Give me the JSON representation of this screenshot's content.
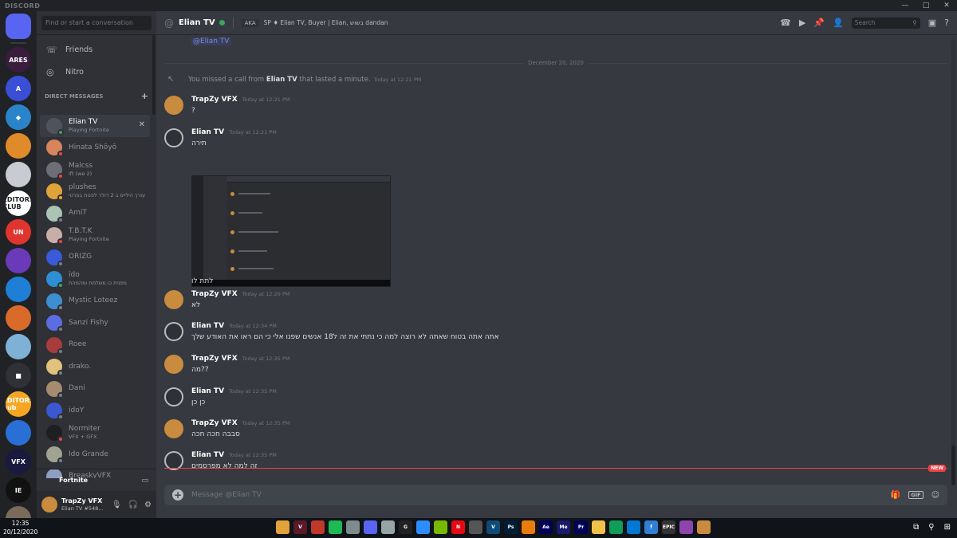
{
  "app": {
    "brand": "DISCORD",
    "window_controls": [
      "—",
      "□",
      "✕"
    ]
  },
  "colors": {
    "accent": "#5865f2",
    "online": "#3ba55d",
    "dnd": "#ed4245",
    "idle": "#faa81a",
    "offline": "#747f8d"
  },
  "sidebar": {
    "search_placeholder": "Find or start a conversation",
    "friends": "Friends",
    "nitro": "Nitro",
    "dm_header": "DIRECT MESSAGES",
    "dms": [
      {
        "name": "Elian TV",
        "sub": "Playing Fortnite",
        "status": "online",
        "color": "#4f545c"
      },
      {
        "name": "Hinata Shōyō",
        "sub": "",
        "status": "dnd",
        "color": "#d8845c"
      },
      {
        "name": "Malcss",
        "sub": "ift (we 2)",
        "status": "dnd",
        "color": "#6d6f78"
      },
      {
        "name": "plushes",
        "sub": "עורך הילייס ב 2 דולר לפנות בפרטי",
        "status": "idle",
        "color": "#e0a33a"
      },
      {
        "name": "AmiT",
        "sub": "",
        "status": "offline",
        "color": "#a9c4b5"
      },
      {
        "name": "T.B.T.K",
        "sub": "Playing Fortnite",
        "status": "dnd",
        "color": "#c9ada7"
      },
      {
        "name": "ORIZG",
        "sub": "",
        "status": "offline",
        "color": "#3a5bd9"
      },
      {
        "name": "ido",
        "sub": "מפנית כו משלמת ומהמהת",
        "status": "online",
        "color": "#2e8fd6"
      },
      {
        "name": "Mystic Loteez",
        "sub": "",
        "status": "offline",
        "color": "#3c8fd1"
      },
      {
        "name": "Sanzi Fishy",
        "sub": "",
        "status": "offline",
        "color": "#5b6ee1"
      },
      {
        "name": "Roee",
        "sub": "",
        "status": "offline",
        "color": "#a83c3c"
      },
      {
        "name": "drako.",
        "sub": "",
        "status": "offline",
        "color": "#e2c27a"
      },
      {
        "name": "Dani",
        "sub": "",
        "status": "offline",
        "color": "#a58b6f"
      },
      {
        "name": "idoY",
        "sub": "",
        "status": "offline",
        "color": "#3b57d1"
      },
      {
        "name": "Normiter",
        "sub": "VFX + GFX",
        "status": "dnd",
        "color": "#1e1f22"
      },
      {
        "name": "Ido Grande",
        "sub": "",
        "status": "offline",
        "color": "#a0a38f"
      },
      {
        "name": "BreaskyVFX",
        "sub": "",
        "status": "offline",
        "color": "#8e9fc2"
      }
    ],
    "activity": "Fortnite",
    "user": {
      "name": "TrapZy VFX",
      "tag": "Elian TV #548..."
    }
  },
  "guilds": [
    {
      "label": "",
      "color": "#5865f2"
    },
    {
      "label": "ARES",
      "color": "#3a1c3d"
    },
    {
      "label": "A",
      "color": "#3b4ed6"
    },
    {
      "label": "◆",
      "color": "#2a84c9"
    },
    {
      "label": "",
      "color": "#e08b2a"
    },
    {
      "label": "",
      "color": "#c8ccd2"
    },
    {
      "label": "EDITORS CLUB",
      "color": "#ffffff"
    },
    {
      "label": "UN",
      "color": "#e0342f"
    },
    {
      "label": "",
      "color": "#6a3ab8"
    },
    {
      "label": "",
      "color": "#1f7fd6"
    },
    {
      "label": "",
      "color": "#d96a2a"
    },
    {
      "label": "",
      "color": "#7fb1d6"
    },
    {
      "label": "■",
      "color": "#2f3136"
    },
    {
      "label": "EDITORS hub",
      "color": "#f5a623"
    },
    {
      "label": "",
      "color": "#2a6fd6"
    },
    {
      "label": "VFX",
      "color": "#1a1a40"
    },
    {
      "label": "IE",
      "color": "#111111"
    },
    {
      "label": "",
      "color": "#7a6a5a"
    }
  ],
  "header": {
    "at": "@",
    "name": "Elian TV",
    "aka_label": "AKA",
    "aka_value": "SP ♦ Elian TV, Buyer | Elian, בשוש dandan",
    "search": "Search"
  },
  "chat": {
    "mention": "@Elian TV",
    "date": "December 20, 2020",
    "call_prefix": "You missed a call from",
    "call_name": "Elian TV",
    "call_suffix": "that lasted a minute.",
    "call_time": "Today at 12:21 PM",
    "messages": [
      {
        "author": "TrapZy VFX",
        "time": "Today at 12:21 PM",
        "text": "?",
        "who": "trap"
      },
      {
        "author": "Elian TV",
        "time": "Today at 12:21 PM",
        "text": "תירה",
        "who": "elian"
      },
      {
        "author": "TrapZy VFX",
        "time": "Today at 12:29 PM",
        "text": "לא",
        "who": "trap"
      },
      {
        "author": "Elian TV",
        "time": "Today at 12:34 PM",
        "text": "אתה אתה בטוח שאתה לא רוצה למה כי נתתי את זה ל18 אנשים שפנו אלי כי הם ראו את האודע שלך",
        "who": "elian"
      },
      {
        "author": "TrapZy VFX",
        "time": "Today at 12:35 PM",
        "text": "מה??",
        "who": "trap"
      },
      {
        "author": "Elian TV",
        "time": "Today at 12:35 PM",
        "text": "כן כן",
        "who": "elian"
      },
      {
        "author": "TrapZy VFX",
        "time": "Today at 12:35 PM",
        "text": "סבבה חכה חכה",
        "who": "trap"
      },
      {
        "author": "Elian TV",
        "time": "Today at 12:35 PM",
        "text": "זה למה לא מפרסמים",
        "who": "elian"
      }
    ],
    "continuation": "לתת לו",
    "new_label": "NEW"
  },
  "composer": {
    "placeholder": "Message @Elian TV",
    "gif": "GIF"
  },
  "taskbar": {
    "time": "12:35",
    "date": "20/12/2020",
    "apps": [
      {
        "label": "",
        "color": "#e0a33a"
      },
      {
        "label": "V",
        "color": "#5a1a2a"
      },
      {
        "label": "",
        "color": "#c0392b"
      },
      {
        "label": "",
        "color": "#1db954"
      },
      {
        "label": "",
        "color": "#7f8c8d"
      },
      {
        "label": "",
        "color": "#5865f2"
      },
      {
        "label": "",
        "color": "#95a5a6"
      },
      {
        "label": "G",
        "color": "#222222"
      },
      {
        "label": "",
        "color": "#2d8cff"
      },
      {
        "label": "",
        "color": "#76b900"
      },
      {
        "label": "N",
        "color": "#e50914"
      },
      {
        "label": "",
        "color": "#555555"
      },
      {
        "label": "V",
        "color": "#0e4b7a"
      },
      {
        "label": "Ps",
        "color": "#001e36"
      },
      {
        "label": "",
        "color": "#e87d0d"
      },
      {
        "label": "Ae",
        "color": "#00005b"
      },
      {
        "label": "Me",
        "color": "#1a1a6e"
      },
      {
        "label": "Pr",
        "color": "#00005b"
      },
      {
        "label": "",
        "color": "#f0c24a"
      },
      {
        "label": "",
        "color": "#0f9d58"
      },
      {
        "label": "",
        "color": "#0078d4"
      },
      {
        "label": "f",
        "color": "#2f7fd6"
      },
      {
        "label": "EPIC",
        "color": "#333333"
      },
      {
        "label": "",
        "color": "#8e44ad"
      },
      {
        "label": "",
        "color": "#c98b3e"
      }
    ]
  }
}
